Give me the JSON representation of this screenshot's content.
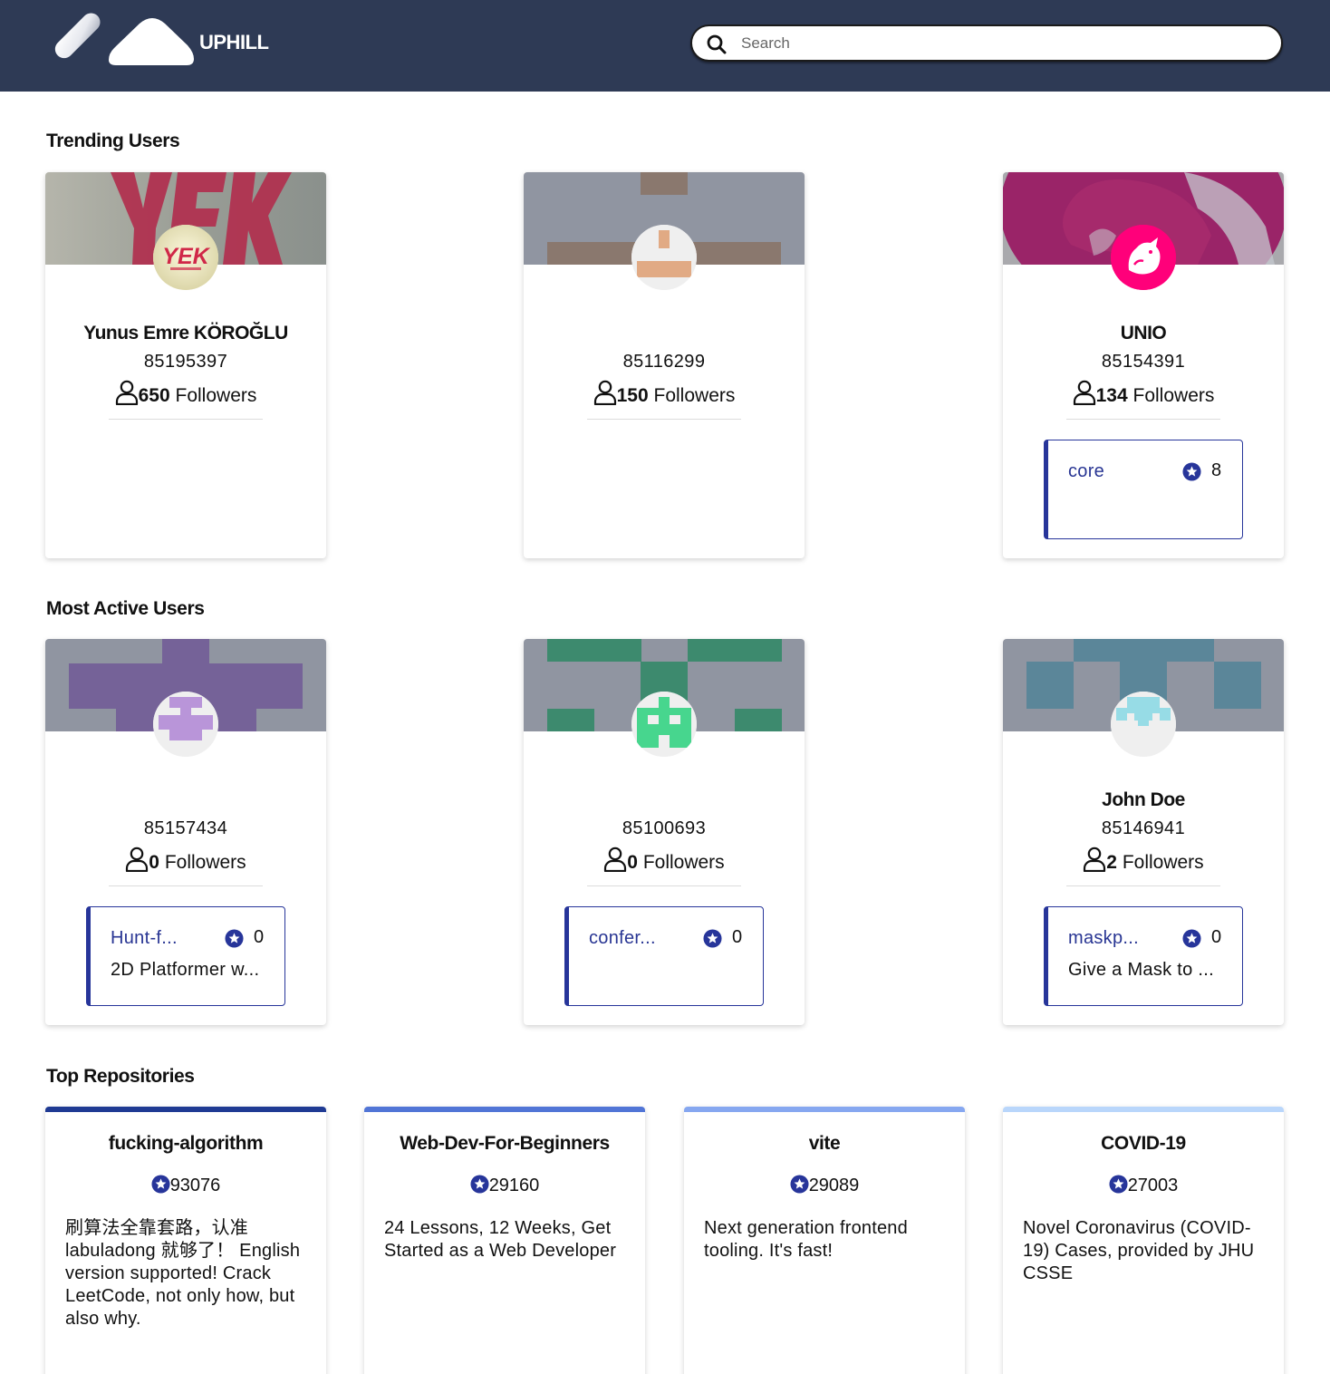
{
  "header": {
    "logo_text": "UPHILL",
    "search_placeholder": "Search"
  },
  "colors": {
    "header_bg": "#2e3a55",
    "accent_blue": "#27359a",
    "top_repo_accents": [
      "#1f3a93",
      "#5175d6",
      "#86a7f0",
      "#b9d6fb"
    ]
  },
  "sections": {
    "trending": "Trending Users",
    "active": "Most Active Users",
    "top_repos": "Top Repositories"
  },
  "trending_users": [
    {
      "name": "Yunus Emre KÖROĞLU",
      "id": "85195397",
      "followers": "650",
      "followers_label": " Followers",
      "avatar": "yek-logo-avatar",
      "repo": null
    },
    {
      "name": "",
      "id": "85116299",
      "followers": "150",
      "followers_label": " Followers",
      "avatar": "identicon-avatar",
      "repo": null
    },
    {
      "name": "UNIO",
      "id": "85154391",
      "followers": "134",
      "followers_label": " Followers",
      "avatar": "unicorn-avatar",
      "repo": {
        "name": "core",
        "stars": "8",
        "description": ""
      }
    }
  ],
  "active_users": [
    {
      "name": "",
      "id": "85157434",
      "followers": "0",
      "followers_label": " Followers",
      "avatar": "identicon-avatar",
      "repo": {
        "name": "Hunt-f...",
        "stars": "0",
        "description": "2D Platformer w..."
      }
    },
    {
      "name": "",
      "id": "85100693",
      "followers": "0",
      "followers_label": " Followers",
      "avatar": "identicon-avatar",
      "repo": {
        "name": "confer...",
        "stars": "0",
        "description": ""
      }
    },
    {
      "name": "John Doe",
      "id": "85146941",
      "followers": "2",
      "followers_label": " Followers",
      "avatar": "identicon-avatar",
      "repo": {
        "name": "maskp...",
        "stars": "0",
        "description": "Give a Mask to ..."
      }
    }
  ],
  "top_repositories": [
    {
      "name": "fucking-algorithm",
      "stars": "93076",
      "description": "刷算法全靠套路，认准 labuladong 就够了！ English version supported! Crack LeetCode, not only how, but also why."
    },
    {
      "name": "Web-Dev-For-Beginners",
      "stars": "29160",
      "description": "24 Lessons, 12 Weeks, Get Started as a Web Developer"
    },
    {
      "name": "vite",
      "stars": "29089",
      "description": "Next generation frontend tooling. It's fast!"
    },
    {
      "name": "COVID-19",
      "stars": "27003",
      "description": "Novel Coronavirus (COVID-19) Cases, provided by JHU CSSE"
    }
  ]
}
